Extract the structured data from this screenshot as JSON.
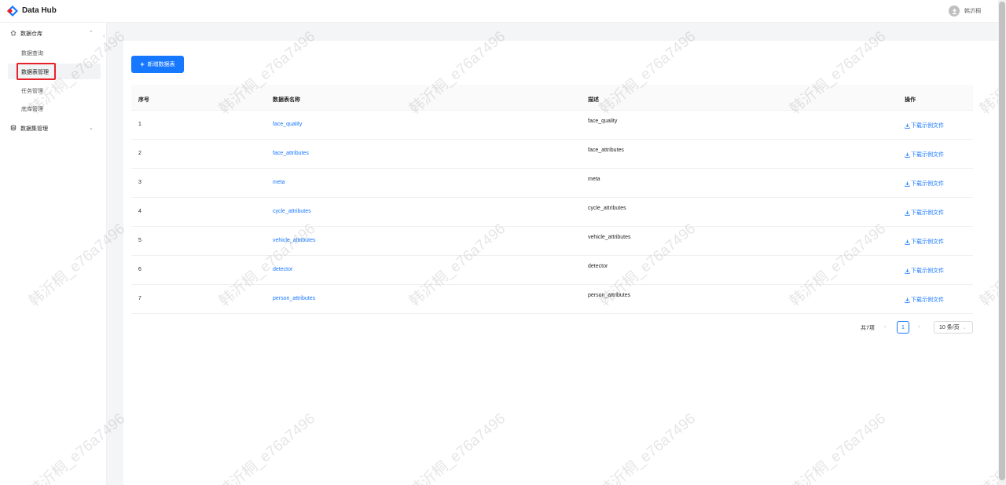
{
  "header": {
    "app_title": "Data Hub",
    "user_name": "韩沂桐"
  },
  "sidebar": {
    "groups": [
      {
        "label": "数据仓库",
        "icon": "home-icon",
        "items": [
          {
            "label": "数据查询"
          },
          {
            "label": "数据表管理",
            "active": true
          },
          {
            "label": "任务管理"
          },
          {
            "label": "底库管理"
          }
        ]
      },
      {
        "label": "数据集管理",
        "icon": "database-icon",
        "items": []
      }
    ]
  },
  "toolbar": {
    "add_button_label": "新增数据表"
  },
  "table": {
    "columns": [
      "序号",
      "数据表名称",
      "描述",
      "操作"
    ],
    "rows": [
      {
        "index": "1",
        "name": "face_quality",
        "desc": "face_quality",
        "action": "下载示例文件"
      },
      {
        "index": "2",
        "name": "face_attributes",
        "desc": "face_attributes",
        "action": "下载示例文件"
      },
      {
        "index": "3",
        "name": "meta",
        "desc": "meta",
        "action": "下载示例文件"
      },
      {
        "index": "4",
        "name": "cycle_attributes",
        "desc": "cycle_attributes",
        "action": "下载示例文件"
      },
      {
        "index": "5",
        "name": "vehicle_attributes",
        "desc": "vehicle_attributes",
        "action": "下载示例文件"
      },
      {
        "index": "6",
        "name": "detector",
        "desc": "detector",
        "action": "下载示例文件"
      },
      {
        "index": "7",
        "name": "person_attributes",
        "desc": "person_attributes",
        "action": "下载示例文件"
      }
    ]
  },
  "pagination": {
    "total_text": "共7项",
    "current_page": "1",
    "page_size": "10 条/页"
  },
  "watermark_text": "韩沂桐_e76a7496",
  "colors": {
    "primary": "#1677ff",
    "highlight": "#e8202a"
  }
}
